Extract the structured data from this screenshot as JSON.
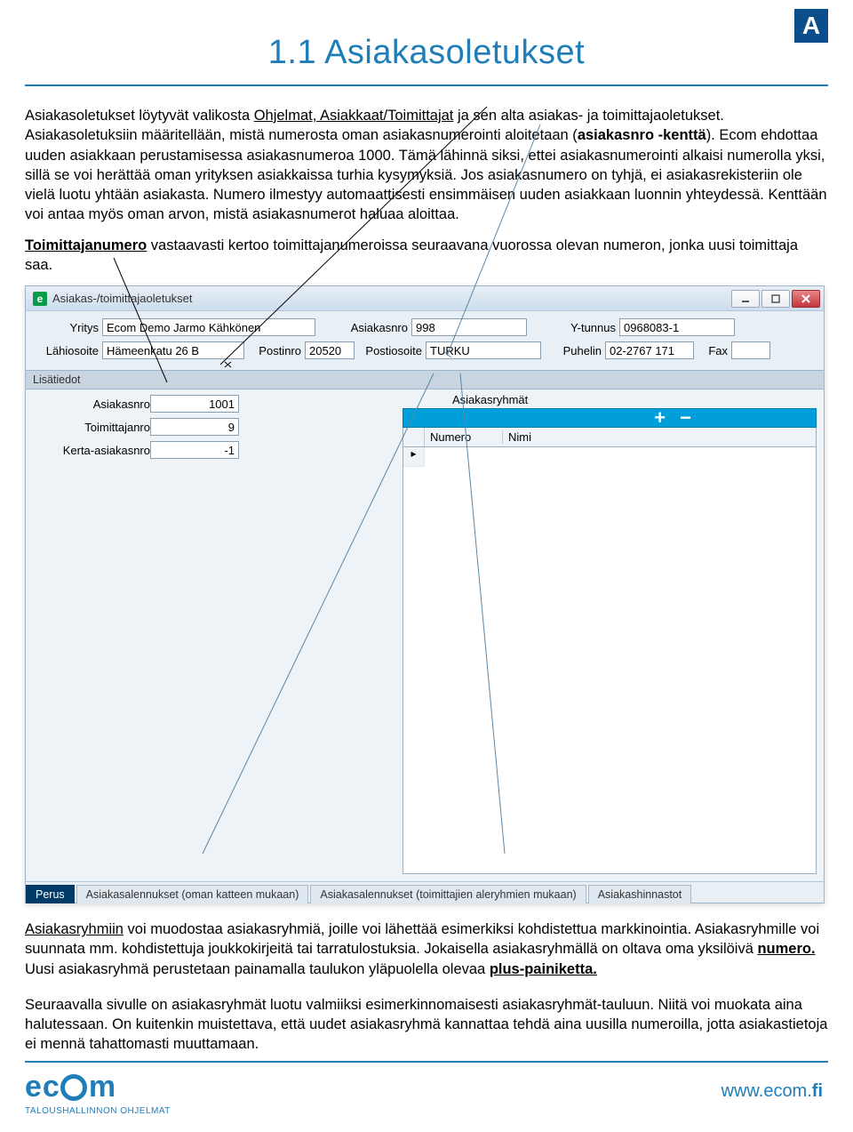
{
  "badge": "A",
  "title": "1.1 Asiakasoletukset",
  "para1_a": "Asiakasoletukset löytyvät valikosta ",
  "para1_link": "Ohjelmat, Asiakkaat/Toimittajat",
  "para1_b": " ja sen alta asiakas- ja toimittajaoletukset. Asiakasoletuksiin määritellään, mistä numerosta oman asiakasnumerointi aloitetaan (",
  "para1_bold": "asiakasnro -kenttä",
  "para1_c": "). Ecom ehdottaa uuden asiakkaan perustamisessa asiakasnumeroa 1000. Tämä lähinnä siksi, ettei asiakasnumerointi alkaisi numerolla yksi, sillä se voi herättää oman yrityksen asiakkaissa turhia kysymyksiä. Jos asiakasnumero on tyhjä, ei asiakasrekisteriin ole vielä luotu yhtään asiakasta. Numero ilmestyy automaattisesti ensimmäisen uuden asiakkaan luonnin yhteydessä. Kenttään voi antaa myös oman arvon, mistä asiakasnumerot haluaa aloittaa.",
  "para2_bold": "Toimittajanumero",
  "para2_rest": " vastaavasti kertoo toimittajanumeroissa seuraavana vuorossa olevan numeron, jonka uusi toimittaja saa.",
  "win": {
    "title": "Asiakas-/toimittajaoletukset",
    "row1": {
      "yritys_lbl": "Yritys",
      "yritys_val": "Ecom Demo Jarmo Kähkönen",
      "asiakasnro_lbl": "Asiakasnro",
      "asiakasnro_val": "998",
      "ytunnus_lbl": "Y-tunnus",
      "ytunnus_val": "0968083-1"
    },
    "row2": {
      "lahi_lbl": "Lähiosoite",
      "lahi_val": "Hämeenkatu 26 B",
      "postinro_lbl": "Postinro",
      "postinro_val": "20520",
      "postiosoite_lbl": "Postiosoite",
      "postiosoite_val": "TURKU",
      "puhelin_lbl": "Puhelin",
      "puhelin_val": "02-2767 171",
      "fax_lbl": "Fax",
      "fax_val": ""
    },
    "tab_lisa": "Lisätiedot",
    "left": {
      "asiakasnro_lbl": "Asiakasnro",
      "asiakasnro_val": "1001",
      "toimittajanro_lbl": "Toimittajanro",
      "toimittajanro_val": "9",
      "kerta_lbl": "Kerta-asiakasnro",
      "kerta_val": "-1"
    },
    "right": {
      "groups_lbl": "Asiakasryhmät",
      "plus": "+",
      "minus": "−",
      "col_num": "Numero",
      "col_name": "Nimi",
      "row_marker": "▸"
    },
    "btabs": {
      "t1": "Perus",
      "t2": "Asiakasalennukset (oman katteen mukaan)",
      "t3": "Asiakasalennukset (toimittajien aleryhmien mukaan)",
      "t4": "Asiakashinnastot"
    }
  },
  "para3_lead_u": "Asiakasryhmiin",
  "para3_a": " voi muodostaa asiakasryhmiä, joille voi lähettää esimerkiksi kohdistettua markkinointia. Asiakasryhmille voi suunnata mm. kohdistettuja joukkokirjeitä tai tarratulostuksia. Jokaisella asiakasryhmällä on oltava oma yksilöivä ",
  "para3_num": "numero.",
  "para3_b": " Uusi asiakasryhmä perustetaan painamalla taulukon yläpuolella olevaa ",
  "para3_plus": "plus-painiketta.",
  "para4": "Seuraavalla sivulle on asiakasryhmät luotu valmiiksi esimerkinnomaisesti asiakasryhmät-tauluun. Niitä voi muokata aina halutessaan. On kuitenkin muistettava, että uudet asiakasryhmä kannattaa tehdä aina uusilla numeroilla, jotta asiakastietoja ei mennä tahattomasti muuttamaan.",
  "footer": {
    "brand": "ecom",
    "tagline": "TALOUSHALLINNON OHJELMAT",
    "url_a": "www.ecom.",
    "url_b": "fi"
  }
}
